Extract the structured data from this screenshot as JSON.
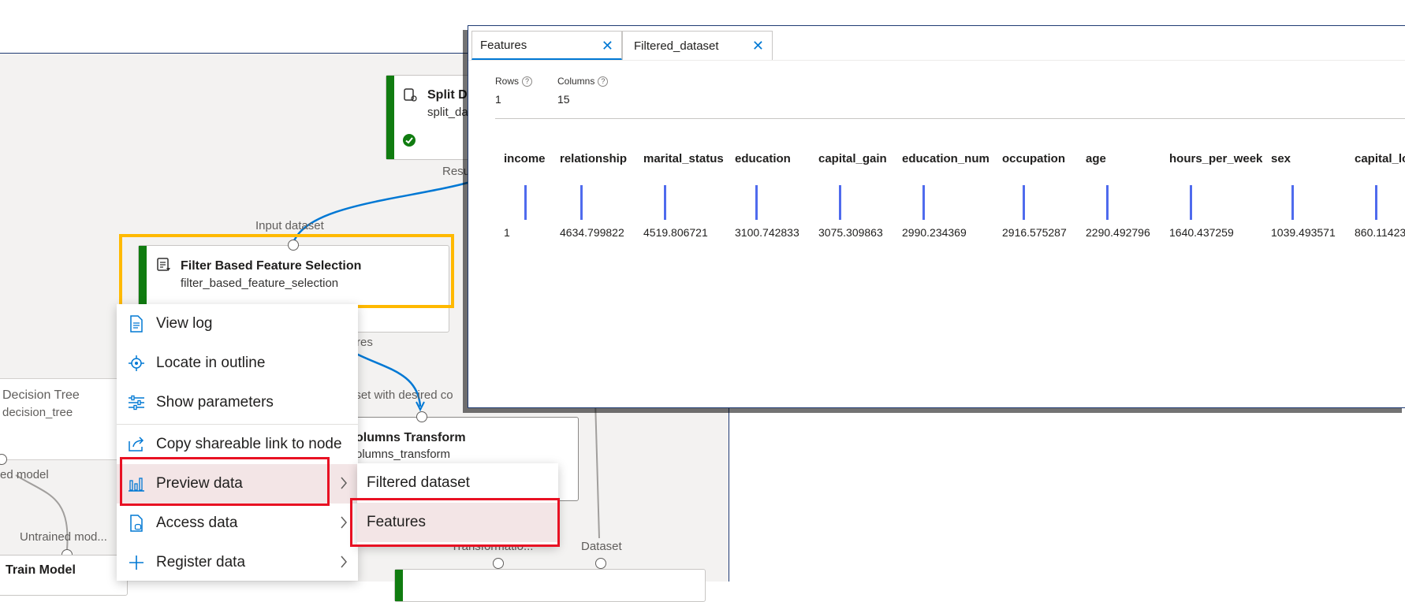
{
  "canvas": {
    "split_node": {
      "title": "Split D",
      "subtitle": "split_da"
    },
    "split_output_label": "Resu",
    "filter_node": {
      "input_port_label": "Input dataset",
      "title": "Filter Based Feature Selection",
      "subtitle": "filter_based_feature_selection",
      "output_port_fragment": "res"
    },
    "decision_tree_node": {
      "title": "Decision Tree",
      "subtitle": "decision_tree",
      "output_label": "ed model"
    },
    "columns_transform_node": {
      "input_port_label": "aset with desired co",
      "title": "olumns Transform",
      "subtitle": "olumns_transform"
    },
    "train_model_node": {
      "input_label": "Untrained mod...",
      "title": "Train Model"
    },
    "bottom_ports": {
      "transformation_label": "Transformatio...",
      "dataset_label": "Dataset"
    }
  },
  "context_menu": {
    "items": [
      {
        "label": "View log",
        "icon": "document-log-icon"
      },
      {
        "label": "Locate in outline",
        "icon": "locate-icon"
      },
      {
        "label": "Show parameters",
        "icon": "sliders-icon"
      },
      {
        "label": "Copy shareable link to node",
        "icon": "share-icon"
      },
      {
        "label": "Preview data",
        "icon": "chart-bar-icon",
        "has_submenu": true
      },
      {
        "label": "Access data",
        "icon": "data-file-icon",
        "has_submenu": true
      },
      {
        "label": "Register data",
        "icon": "plus-icon",
        "has_submenu": true
      }
    ]
  },
  "submenu": {
    "items": [
      {
        "label": "Filtered dataset"
      },
      {
        "label": "Features"
      }
    ]
  },
  "preview_panel": {
    "tabs": [
      {
        "label": "Features",
        "active": true
      },
      {
        "label": "Filtered_dataset",
        "active": false
      }
    ],
    "stats": {
      "rows_label": "Rows",
      "rows_value": "1",
      "columns_label": "Columns",
      "columns_value": "15"
    },
    "columns": [
      {
        "name": "income",
        "value": "1"
      },
      {
        "name": "relationship",
        "value": "4634.799822"
      },
      {
        "name": "marital_status",
        "value": "4519.806721"
      },
      {
        "name": "education",
        "value": "3100.742833"
      },
      {
        "name": "capital_gain",
        "value": "3075.309863"
      },
      {
        "name": "education_num",
        "value": "2990.234369"
      },
      {
        "name": "occupation",
        "value": "2916.575287"
      },
      {
        "name": "age",
        "value": "2290.492796"
      },
      {
        "name": "hours_per_week",
        "value": "1640.437259"
      },
      {
        "name": "sex",
        "value": "1039.493571"
      },
      {
        "name": "capital_lo",
        "value": "860.11423"
      }
    ]
  },
  "colors": {
    "accent": "#0078d4",
    "highlight_red": "#e81123",
    "highlight_yellow": "#ffb900",
    "success_green": "#107c10",
    "histogram_bar": "#4f6bed"
  }
}
